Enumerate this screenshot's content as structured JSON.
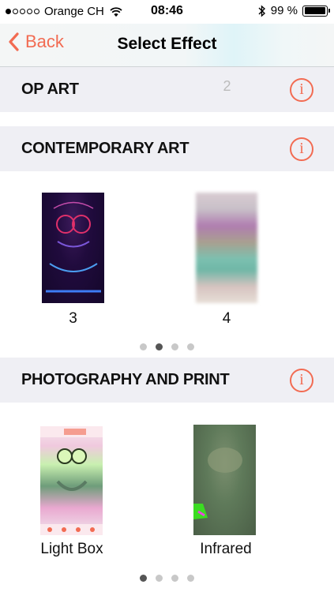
{
  "status_bar": {
    "carrier": "Orange CH",
    "time": "08:46",
    "battery_percent": "99 %",
    "battery_level": 0.99,
    "signal_bars_filled": 1,
    "signal_bars_total": 5
  },
  "nav": {
    "back_label": "Back",
    "title": "Select Effect"
  },
  "sections": [
    {
      "title": "OP ART",
      "info_glyph": "i",
      "items": [
        {
          "label": ""
        },
        {
          "label": "2"
        }
      ]
    },
    {
      "title": "CONTEMPORARY ART",
      "info_glyph": "i",
      "items": [
        {
          "label": "3"
        },
        {
          "label": "4"
        }
      ],
      "pager": {
        "pages": 4,
        "active": 2
      }
    },
    {
      "title": "PHOTOGRAPHY AND PRINT",
      "info_glyph": "i",
      "items": [
        {
          "label": "Light Box"
        },
        {
          "label": "Infrared"
        }
      ],
      "pager": {
        "pages": 4,
        "active": 1
      }
    }
  ],
  "colors": {
    "accent": "#f26b52",
    "section_bg": "#efeff4"
  },
  "icons": {
    "back": "chevron-left-icon",
    "info": "info-icon",
    "wifi": "wifi-icon",
    "bluetooth": "bluetooth-icon",
    "battery": "battery-icon"
  }
}
